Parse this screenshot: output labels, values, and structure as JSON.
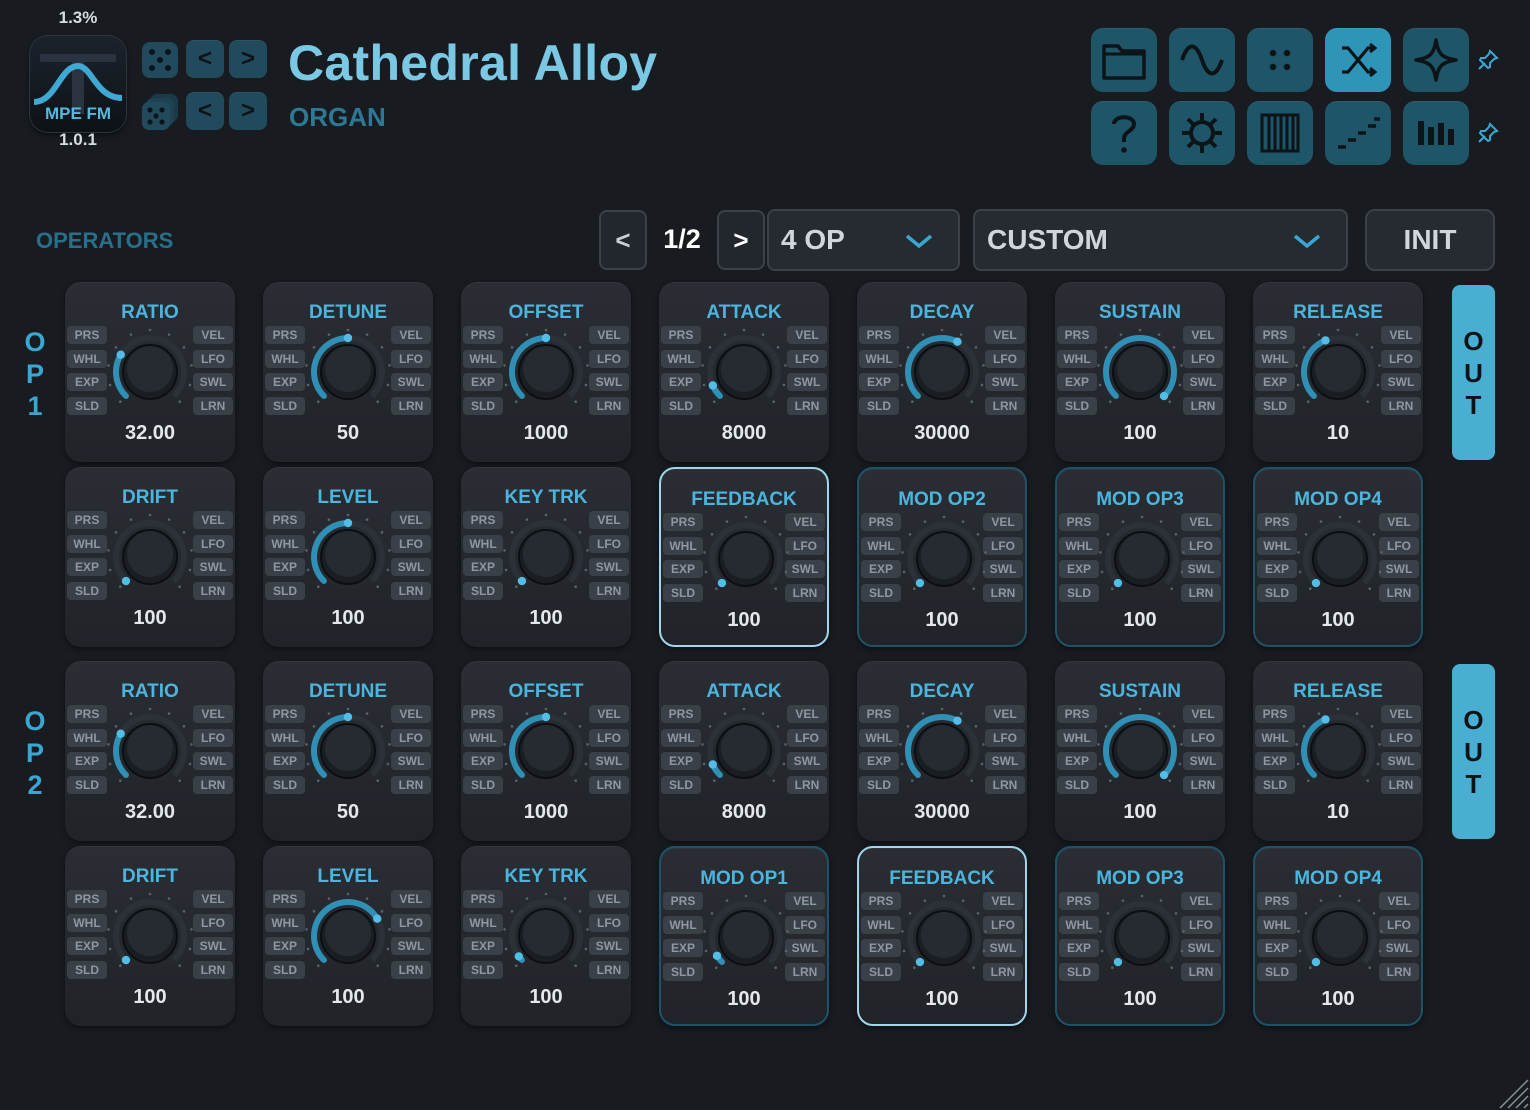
{
  "header": {
    "cpu": "1.3%",
    "logo_text": "MPE FM",
    "version": "1.0.1",
    "preset_name": "Cathedral Alloy",
    "preset_category": "ORGAN",
    "nav_prev": "<",
    "nav_next": ">"
  },
  "toolbar": [
    {
      "name": "folder-icon",
      "active": false
    },
    {
      "name": "lfo-wave-icon",
      "active": false
    },
    {
      "name": "dots-icon",
      "active": false
    },
    {
      "name": "routing-icon",
      "active": true
    },
    {
      "name": "sparkle-icon",
      "active": false
    },
    {
      "name": "help-icon",
      "active": false
    },
    {
      "name": "gear-icon",
      "active": false
    },
    {
      "name": "keyboard-icon",
      "active": false
    },
    {
      "name": "arpeggio-icon",
      "active": false
    },
    {
      "name": "mixer-icon",
      "active": false
    }
  ],
  "controls": {
    "section_label": "OPERATORS",
    "prev": "<",
    "page": "1/2",
    "next": ">",
    "op_count": "4 OP",
    "algorithm": "CUSTOM",
    "init": "INIT"
  },
  "mod_buttons": {
    "left": [
      "PRS",
      "WHL",
      "EXP",
      "SLD"
    ],
    "right": [
      "VEL",
      "LFO",
      "SWL",
      "LRN"
    ]
  },
  "operators": [
    {
      "label": [
        "O",
        "P",
        "1"
      ],
      "out": [
        "O",
        "U",
        "T"
      ],
      "rows": [
        [
          {
            "title": "RATIO",
            "value": "32.00",
            "level": 0.28,
            "style": "normal"
          },
          {
            "title": "DETUNE",
            "value": "50",
            "level": 0.5,
            "style": "normal"
          },
          {
            "title": "OFFSET",
            "value": "1000",
            "level": 0.5,
            "style": "normal"
          },
          {
            "title": "ATTACK",
            "value": "8000",
            "level": 0.08,
            "style": "normal"
          },
          {
            "title": "DECAY",
            "value": "30000",
            "level": 0.6,
            "style": "normal"
          },
          {
            "title": "SUSTAIN",
            "value": "100",
            "level": 1.0,
            "style": "normal"
          },
          {
            "title": "RELEASE",
            "value": "10",
            "level": 0.42,
            "style": "normal"
          }
        ],
        [
          {
            "title": "DRIFT",
            "value": "100",
            "level": 0.0,
            "style": "normal"
          },
          {
            "title": "LEVEL",
            "value": "100",
            "level": 0.5,
            "style": "normal"
          },
          {
            "title": "KEY TRK",
            "value": "100",
            "level": 0.0,
            "style": "normal"
          },
          {
            "title": "FEEDBACK",
            "value": "100",
            "level": 0.0,
            "style": "fb"
          },
          {
            "title": "MOD OP2",
            "value": "100",
            "level": 0.0,
            "style": "mod"
          },
          {
            "title": "MOD OP3",
            "value": "100",
            "level": 0.0,
            "style": "mod"
          },
          {
            "title": "MOD OP4",
            "value": "100",
            "level": 0.0,
            "style": "mod"
          }
        ]
      ]
    },
    {
      "label": [
        "O",
        "P",
        "2"
      ],
      "out": [
        "O",
        "U",
        "T"
      ],
      "rows": [
        [
          {
            "title": "RATIO",
            "value": "32.00",
            "level": 0.28,
            "style": "normal"
          },
          {
            "title": "DETUNE",
            "value": "50",
            "level": 0.5,
            "style": "normal"
          },
          {
            "title": "OFFSET",
            "value": "1000",
            "level": 0.5,
            "style": "normal"
          },
          {
            "title": "ATTACK",
            "value": "8000",
            "level": 0.08,
            "style": "normal"
          },
          {
            "title": "DECAY",
            "value": "30000",
            "level": 0.6,
            "style": "normal"
          },
          {
            "title": "SUSTAIN",
            "value": "100",
            "level": 1.0,
            "style": "normal"
          },
          {
            "title": "RELEASE",
            "value": "10",
            "level": 0.42,
            "style": "normal"
          }
        ],
        [
          {
            "title": "DRIFT",
            "value": "100",
            "level": 0.0,
            "style": "normal"
          },
          {
            "title": "LEVEL",
            "value": "100",
            "level": 0.72,
            "style": "normal"
          },
          {
            "title": "KEY TRK",
            "value": "100",
            "level": 0.03,
            "style": "normal"
          },
          {
            "title": "MOD OP1",
            "value": "100",
            "level": 0.05,
            "style": "mod"
          },
          {
            "title": "FEEDBACK",
            "value": "100",
            "level": 0.0,
            "style": "fb"
          },
          {
            "title": "MOD OP3",
            "value": "100",
            "level": 0.0,
            "style": "mod"
          },
          {
            "title": "MOD OP4",
            "value": "100",
            "level": 0.0,
            "style": "mod"
          }
        ]
      ]
    }
  ],
  "colors": {
    "accent": "#4cb5de",
    "background": "#181c21",
    "card": "#25292f",
    "toolbar": "#1f5568",
    "toolbar_active": "#2f95b8"
  }
}
